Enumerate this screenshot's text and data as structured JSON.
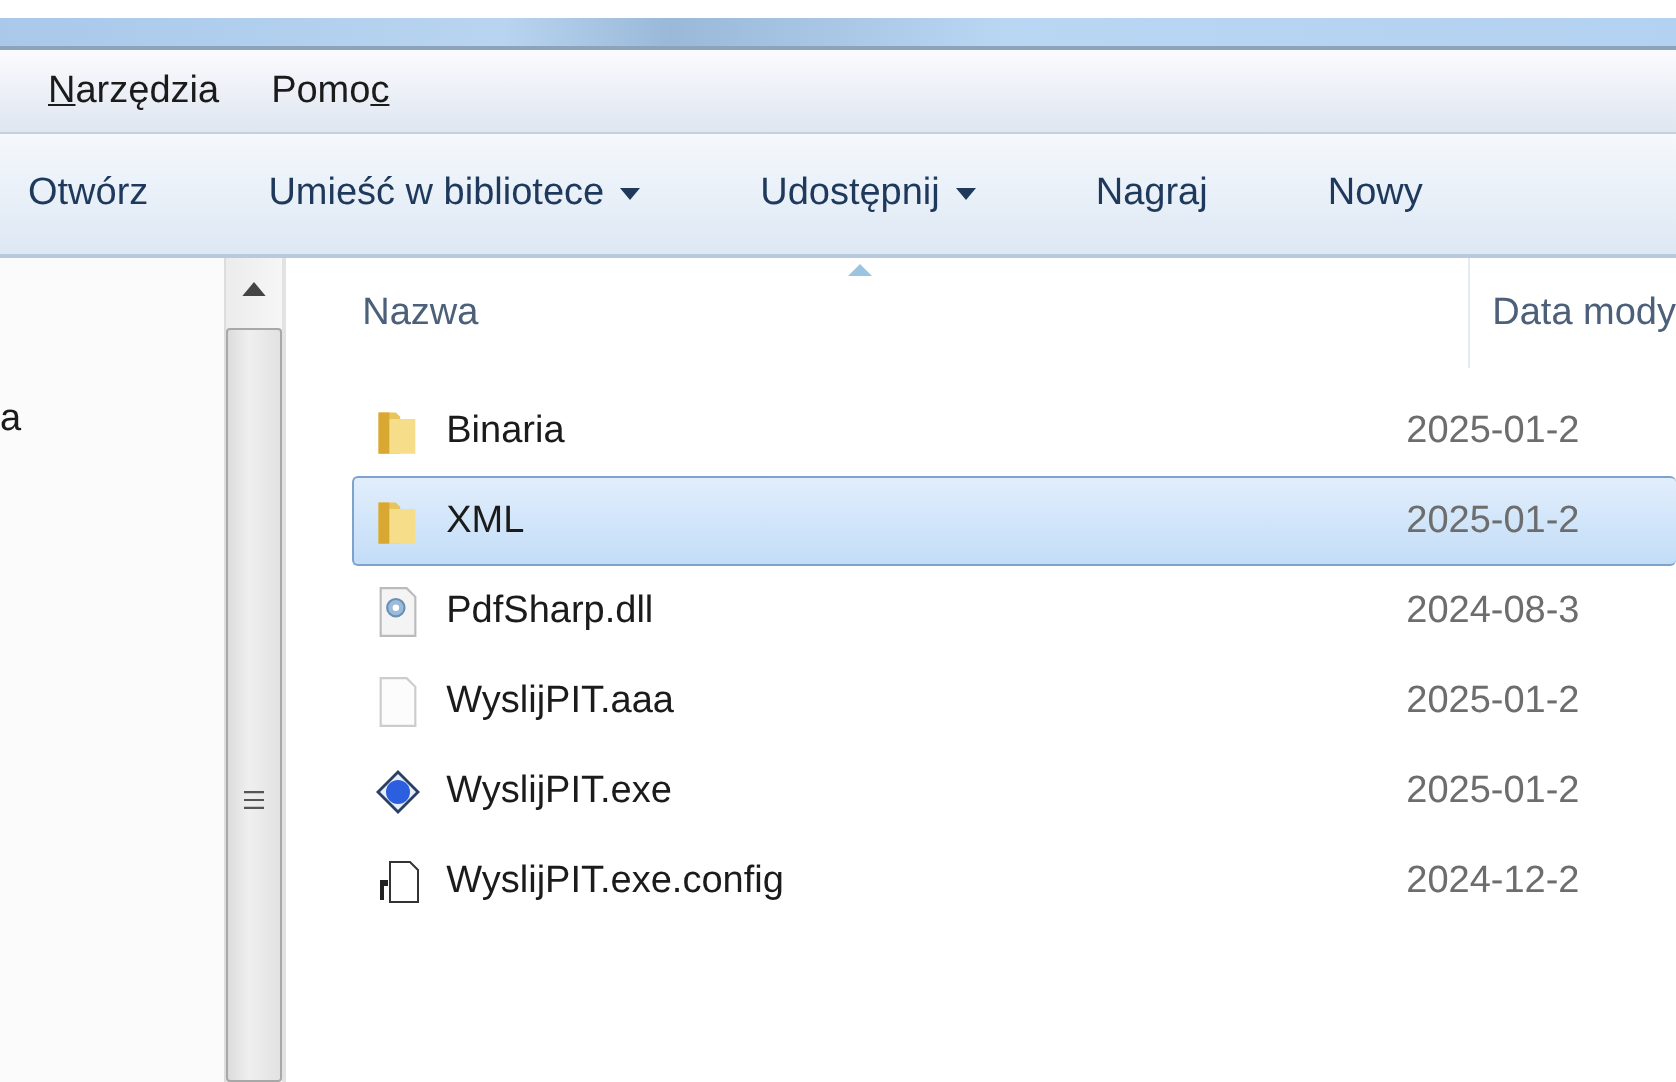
{
  "menu": [
    {
      "key": "N",
      "after": "arzędzia"
    },
    {
      "before": "Pomo",
      "key": "c"
    }
  ],
  "toolbar": [
    {
      "label": "Otwórz",
      "dropdown": false
    },
    {
      "label": "Umieść w bibliotece",
      "dropdown": true
    },
    {
      "label": "Udostępnij",
      "dropdown": true
    },
    {
      "label": "Nagraj",
      "dropdown": false
    },
    {
      "label": "Nowy",
      "dropdown": false
    }
  ],
  "nav_pane": {
    "items": [
      {
        "label": "a"
      }
    ]
  },
  "file_list": {
    "columns": [
      "Nazwa",
      "Data mody"
    ],
    "rows": [
      {
        "name": "Binaria",
        "date": "2025-01-2",
        "kind": "folder",
        "selected": false
      },
      {
        "name": "XML",
        "date": "2025-01-2",
        "kind": "folder",
        "selected": true
      },
      {
        "name": "PdfSharp.dll",
        "date": "2024-08-3",
        "kind": "dll",
        "selected": false
      },
      {
        "name": "WyslijPIT.aaa",
        "date": "2025-01-2",
        "kind": "file",
        "selected": false
      },
      {
        "name": "WyslijPIT.exe",
        "date": "2025-01-2",
        "kind": "exe",
        "selected": false
      },
      {
        "name": "WyslijPIT.exe.config",
        "date": "2024-12-2",
        "kind": "config",
        "selected": false
      }
    ]
  }
}
